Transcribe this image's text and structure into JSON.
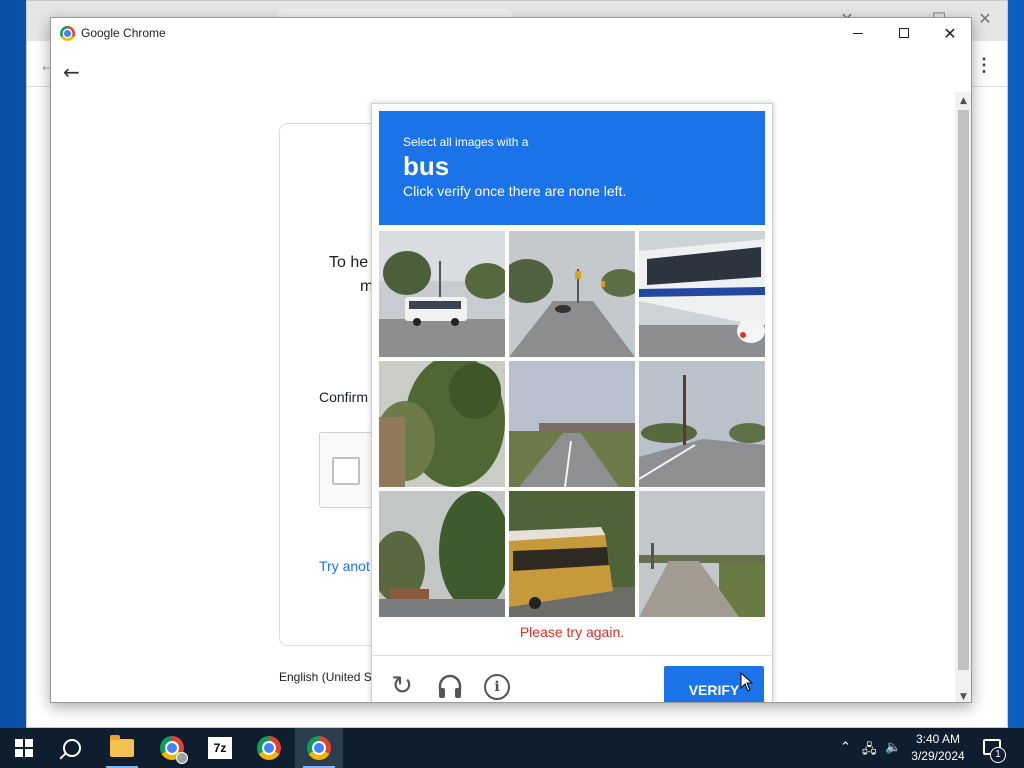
{
  "window": {
    "title": "Google Chrome"
  },
  "page": {
    "help_text": "To he",
    "help_text_line2": "m",
    "confirm_text": "Confirm",
    "try_another": "Try anot",
    "language": "English (United S"
  },
  "challenge": {
    "select_text": "Select all images with a",
    "target": "bus",
    "instruction": "Click verify once there are none left.",
    "error": "Please try again.",
    "verify_label": "VERIFY",
    "reload_icon": "reload-icon",
    "audio_icon": "headphones-icon",
    "info_icon": "info-icon",
    "info_glyph": "i",
    "tiles": [
      {
        "scene": "bus on road with trees"
      },
      {
        "scene": "road with traffic light"
      },
      {
        "scene": "bus side closeup"
      },
      {
        "scene": "trees"
      },
      {
        "scene": "road with overpass"
      },
      {
        "scene": "road with utility pole"
      },
      {
        "scene": "trees and road"
      },
      {
        "scene": "school bus"
      },
      {
        "scene": "empty road"
      }
    ]
  },
  "taskbar": {
    "time": "3:40 AM",
    "date": "3/29/2024",
    "notification_count": "1",
    "apps": [
      "start",
      "search",
      "file-explorer",
      "chrome-profile",
      "7-zip",
      "chrome",
      "chrome-active"
    ]
  },
  "colors": {
    "accent": "#1a73e8",
    "error": "#d93025"
  }
}
